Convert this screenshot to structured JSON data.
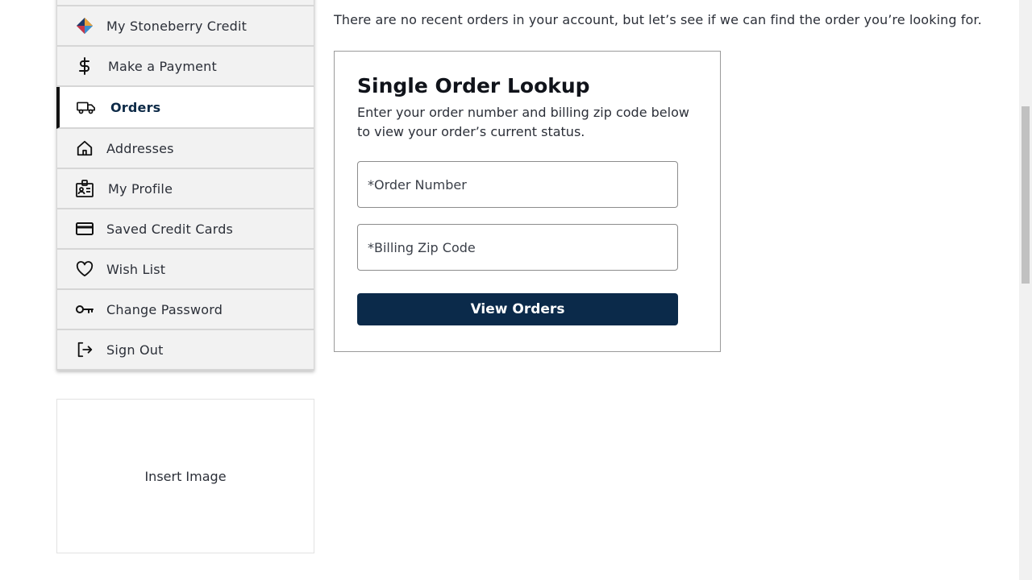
{
  "sidebar": {
    "items": [
      {
        "label": "My Stoneberry Credit",
        "icon": "stoneberry-credit-icon"
      },
      {
        "label": "Make a Payment",
        "icon": "dollar-icon"
      },
      {
        "label": "Orders",
        "icon": "truck-icon",
        "active": true
      },
      {
        "label": "Addresses",
        "icon": "home-icon"
      },
      {
        "label": "My Profile",
        "icon": "profile-badge-icon"
      },
      {
        "label": "Saved Credit Cards",
        "icon": "credit-card-icon"
      },
      {
        "label": "Wish List",
        "icon": "heart-icon"
      },
      {
        "label": "Change Password",
        "icon": "key-icon"
      },
      {
        "label": "Sign Out",
        "icon": "sign-out-icon"
      }
    ]
  },
  "image_card": {
    "label": "Insert Image"
  },
  "main": {
    "intro": "There are no recent orders in your account, but let’s see if we can find the order you’re looking for.",
    "lookup": {
      "title": "Single Order Lookup",
      "description": "Enter your order number and billing zip code below to view your order’s current status.",
      "order_number_placeholder": "*Order Number",
      "zip_placeholder": "*Billing Zip Code",
      "button_label": "View Orders"
    }
  },
  "colors": {
    "accent": "#0b2a4a",
    "active_border": "#111111",
    "sidebar_bg": "#f2f2f2"
  }
}
